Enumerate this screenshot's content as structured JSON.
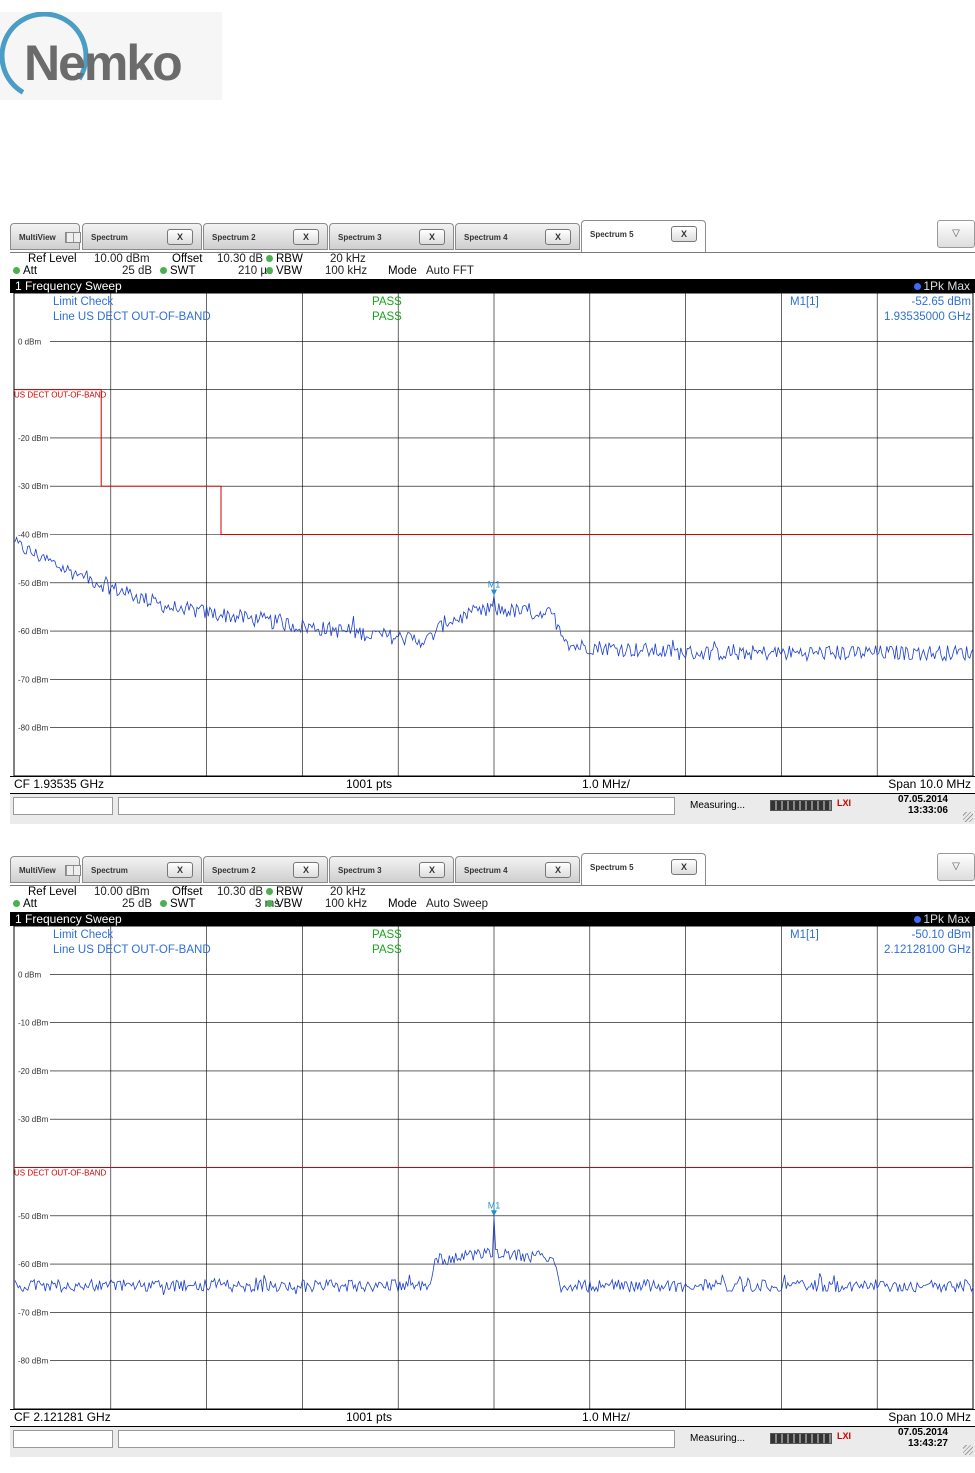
{
  "logo": {
    "text": "Nemko"
  },
  "tabs": [
    "MultiView",
    "Spectrum",
    "Spectrum 2",
    "Spectrum 3",
    "Spectrum 4",
    "Spectrum 5"
  ],
  "tab_close": "X",
  "dropdown_glyph": "▽",
  "labels": {
    "ref_level": "Ref Level",
    "att": "Att",
    "offset": "Offset",
    "swt": "SWT",
    "rbw": "RBW",
    "vbw": "VBW",
    "mode": "Mode",
    "sweep_title": "1 Frequency Sweep",
    "trace": "1Pk Max",
    "limit_check": "Limit Check",
    "limit_line": "Line US DECT OUT-OF-BAND",
    "limit_line_label": "US DECT OUT-OF-BAND",
    "marker": "M1[1]",
    "marker_tag": "M1",
    "points": "1001 pts",
    "div": "1.0 MHz/",
    "measuring": "Measuring...",
    "lxi": "LXI"
  },
  "screens": [
    {
      "ref_level": "10.00 dBm",
      "att": "25 dB",
      "offset": "10.30 dB",
      "swt": "210 µs",
      "rbw": "20 kHz",
      "vbw": "100 kHz",
      "mode": "Auto FFT",
      "limit_check_result": "PASS",
      "limit_line_result": "PASS",
      "marker_level": "-52.65 dBm",
      "marker_freq": "1.93535000 GHz",
      "cf": "CF 1.93535 GHz",
      "span": "Span 10.0 MHz",
      "date": "07.05.2014",
      "time": "13:33:06",
      "y_ticks": [
        "0 dBm",
        "",
        "-20 dBm",
        "-30 dBm",
        "-40 dBm",
        "-50 dBm",
        "-60 dBm",
        "-70 dBm",
        "-80 dBm"
      ],
      "limit_line_dbm": [
        [
          0,
          -10
        ],
        [
          0.9,
          -10
        ],
        [
          0.9,
          -30
        ],
        [
          2.15,
          -30
        ],
        [
          2.15,
          -40
        ],
        [
          10,
          -40
        ]
      ],
      "marker_x": 5.0,
      "marker_y": -52.65,
      "trace_profile": [
        [
          0,
          -42
        ],
        [
          0.5,
          -47
        ],
        [
          1,
          -51
        ],
        [
          1.6,
          -55
        ],
        [
          3,
          -59
        ],
        [
          4.3,
          -62
        ],
        [
          4.5,
          -58
        ],
        [
          5,
          -55.5
        ],
        [
          5.6,
          -56.5
        ],
        [
          5.8,
          -63
        ],
        [
          7,
          -64.5
        ],
        [
          10,
          -64.5
        ]
      ],
      "noise_dB": 1.6
    },
    {
      "ref_level": "10.00 dBm",
      "att": "25 dB",
      "offset": "10.30 dB",
      "swt": "3 ms",
      "rbw": "20 kHz",
      "vbw": "100 kHz",
      "mode": "Auto Sweep",
      "limit_check_result": "PASS",
      "limit_line_result": "PASS",
      "marker_level": "-50.10 dBm",
      "marker_freq": "2.12128100 GHz",
      "cf": "CF 2.121281 GHz",
      "span": "Span 10.0 MHz",
      "date": "07.05.2014",
      "time": "13:43:27",
      "y_ticks": [
        "0 dBm",
        "-10 dBm",
        "-20 dBm",
        "-30 dBm",
        "",
        "-50 dBm",
        "-60 dBm",
        "-70 dBm",
        "-80 dBm"
      ],
      "limit_line_dbm": [
        [
          0,
          -40
        ],
        [
          10,
          -40
        ]
      ],
      "marker_x": 5.0,
      "marker_y": -50.1,
      "trace_profile": [
        [
          0,
          -64.5
        ],
        [
          4.3,
          -64.5
        ],
        [
          4.4,
          -59
        ],
        [
          5,
          -58
        ],
        [
          5.6,
          -58.5
        ],
        [
          5.7,
          -64.5
        ],
        [
          10,
          -64.5
        ]
      ],
      "noise_dB": 1.3
    }
  ],
  "colors": {
    "trace": "#1c3fd1",
    "limit": "#d00000",
    "marker": "#1d8fd1",
    "pass": "#1aa31a",
    "info": "#2f6fd8",
    "grid": "#000000"
  }
}
